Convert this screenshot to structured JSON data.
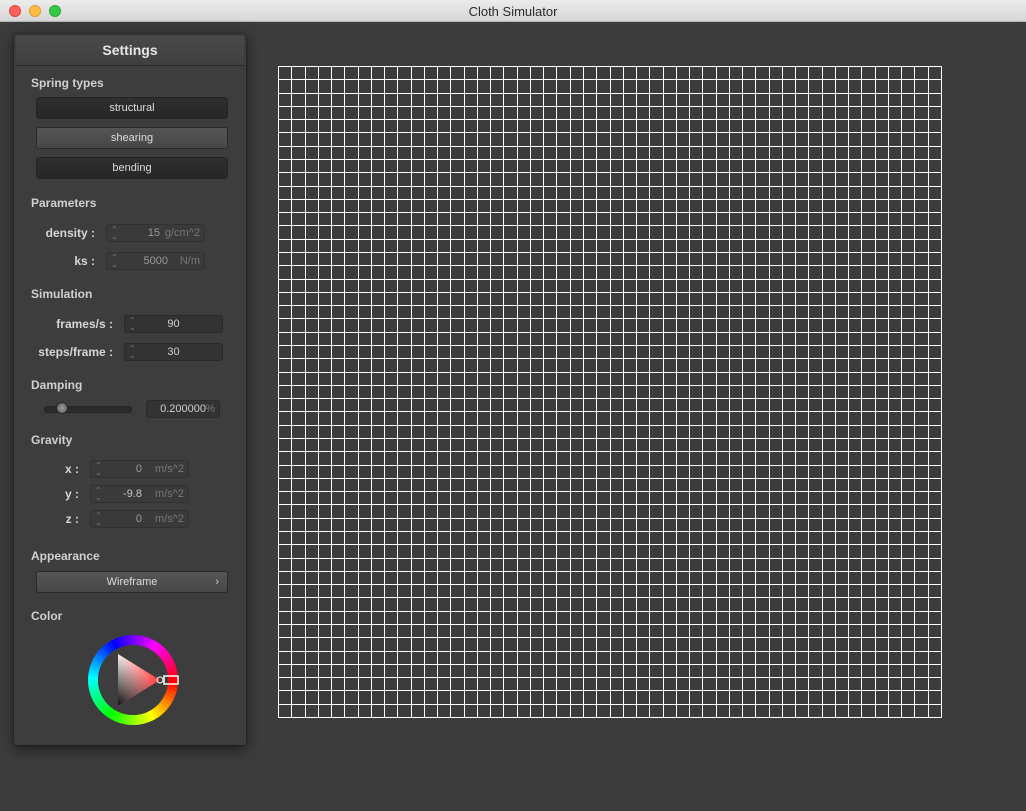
{
  "window": {
    "title": "Cloth Simulator"
  },
  "panel": {
    "title": "Settings",
    "spring_types": {
      "heading": "Spring types",
      "buttons": [
        {
          "label": "structural",
          "state": "pressed"
        },
        {
          "label": "shearing",
          "state": "normal"
        },
        {
          "label": "bending",
          "state": "pressed"
        }
      ]
    },
    "parameters": {
      "heading": "Parameters",
      "density": {
        "label": "density :",
        "value": "15",
        "unit": "g/cm^2"
      },
      "ks": {
        "label": "ks :",
        "value": "5000",
        "unit": "N/m"
      }
    },
    "simulation": {
      "heading": "Simulation",
      "fps": {
        "label": "frames/s :",
        "value": "90"
      },
      "steps": {
        "label": "steps/frame :",
        "value": "30"
      }
    },
    "damping": {
      "heading": "Damping",
      "slider_fraction": 0.2,
      "value": "0.200000",
      "unit": "%"
    },
    "gravity": {
      "heading": "Gravity",
      "x": {
        "label": "x :",
        "value": "0",
        "unit": "m/s^2"
      },
      "y": {
        "label": "y :",
        "value": "-9.8",
        "unit": "m/s^2"
      },
      "z": {
        "label": "z :",
        "value": "0",
        "unit": "m/s^2"
      }
    },
    "appearance": {
      "heading": "Appearance",
      "selected": "Wireframe",
      "chevron": "›"
    },
    "color": {
      "heading": "Color",
      "selected_color": "#ffffff"
    }
  },
  "cloth": {
    "color": "#ffffff",
    "background": "#3c3c3c"
  }
}
